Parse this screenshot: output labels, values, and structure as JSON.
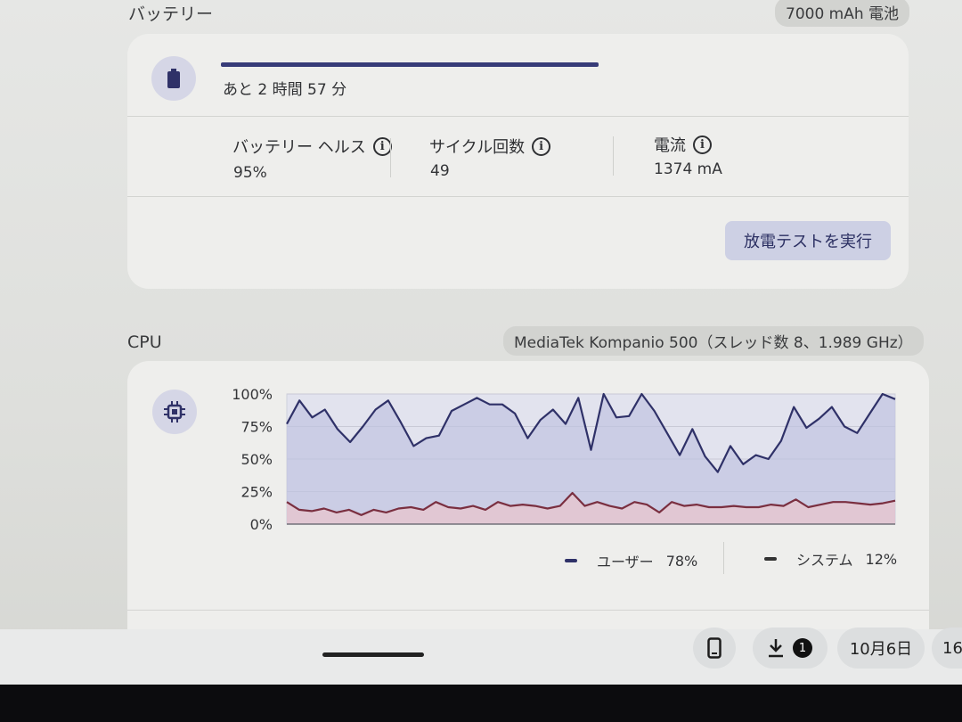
{
  "battery": {
    "section_title": "バッテリー",
    "capacity_chip": "7000 mAh 電池",
    "icon": "battery-icon",
    "charge_fraction": 0.6,
    "time_remaining": "あと 2 時間 57 分",
    "stats": [
      {
        "label": "バッテリー ヘルス",
        "value": "95%"
      },
      {
        "label": "サイクル回数",
        "value": "49"
      },
      {
        "label": "電流",
        "value": "1374 mA"
      }
    ],
    "discharge_button": "放電テストを実行"
  },
  "cpu": {
    "section_title": "CPU",
    "model_chip": "MediaTek Kompanio 500（スレッド数 8、1.989 GHz）",
    "icon": "cpu-chip-icon",
    "legend": [
      {
        "label": "ユーザー",
        "value": "78%",
        "color": "#2f3168"
      },
      {
        "label": "システム",
        "value": "12%",
        "color": "#7a2f40"
      }
    ]
  },
  "shelf": {
    "phone_icon": "phone-hub-icon",
    "download_icon": "download-icon",
    "download_badge": "1",
    "date": "10月6日",
    "time_partial": "16"
  },
  "chart_data": {
    "type": "area",
    "y_tick_labels": [
      "100%",
      "75%",
      "50%",
      "25%",
      "0%"
    ],
    "ylim": [
      0,
      100
    ],
    "grid": true,
    "series": [
      {
        "name": "ユーザー",
        "color": "#2f3168",
        "values": [
          77,
          95,
          82,
          88,
          73,
          63,
          75,
          88,
          95,
          78,
          60,
          66,
          68,
          87,
          92,
          97,
          92,
          92,
          85,
          66,
          80,
          88,
          77,
          97,
          57,
          100,
          82,
          83,
          100,
          87,
          70,
          53,
          73,
          52,
          40,
          60,
          46,
          53,
          50,
          64,
          90,
          74,
          81,
          90,
          75,
          70,
          85,
          100,
          96
        ]
      },
      {
        "name": "システム",
        "color": "#7a2f40",
        "values": [
          17,
          11,
          10,
          12,
          9,
          11,
          7,
          11,
          9,
          12,
          13,
          11,
          17,
          13,
          12,
          14,
          11,
          17,
          14,
          15,
          14,
          12,
          14,
          24,
          14,
          17,
          14,
          12,
          17,
          15,
          9,
          17,
          14,
          15,
          13,
          13,
          14,
          13,
          13,
          15,
          14,
          19,
          13,
          15,
          17,
          17,
          16,
          15,
          16,
          18
        ]
      }
    ]
  }
}
